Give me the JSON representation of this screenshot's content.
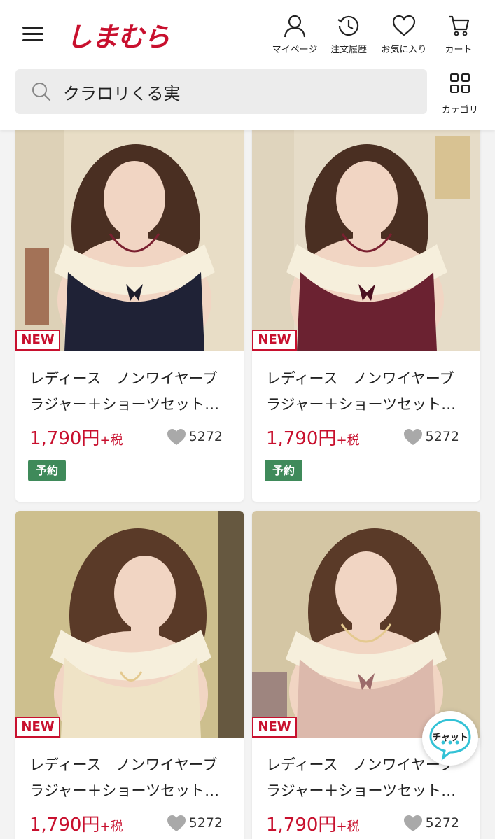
{
  "header": {
    "logo": "しまむら",
    "nav": {
      "mypage": "マイページ",
      "history": "注文履歴",
      "favorites": "お気に入り",
      "cart": "カート"
    },
    "search": {
      "value": "クラロリくる実"
    },
    "category": "カテゴリ"
  },
  "products": [
    {
      "badge": "NEW",
      "title_line1": "レディース　ノンワイヤーブ",
      "title_line2": "ラジャー＋ショーツセット…",
      "price": "1,790円",
      "tax": "+税",
      "likes": "5272",
      "reserve": "予約",
      "colors": {
        "bg": "#e8ddc6",
        "top": "#1f2236"
      }
    },
    {
      "badge": "NEW",
      "title_line1": "レディース　ノンワイヤーブ",
      "title_line2": "ラジャー＋ショーツセット…",
      "price": "1,790円",
      "tax": "+税",
      "likes": "5272",
      "reserve": "予約",
      "colors": {
        "bg": "#e6dcc8",
        "top": "#6b2231"
      }
    },
    {
      "badge": "NEW",
      "title_line1": "レディース　ノンワイヤーブ",
      "title_line2": "ラジャー＋ショーツセット…",
      "price": "1,790円",
      "tax": "+税",
      "likes": "5272",
      "colors": {
        "bg": "#cdbf8e",
        "top": "#efe3c6"
      }
    },
    {
      "badge": "NEW",
      "title_line1": "レディース　ノンワイヤーブ",
      "title_line2": "ラジャー＋ショーツセット…",
      "price": "1,790円",
      "tax": "+税",
      "likes": "5272",
      "colors": {
        "bg": "#d4c6a4",
        "top": "#dcb9ac"
      }
    }
  ],
  "chat": {
    "label": "チャット"
  },
  "colors": {
    "brand": "#c8102e",
    "reserve": "#3f8a5a"
  }
}
